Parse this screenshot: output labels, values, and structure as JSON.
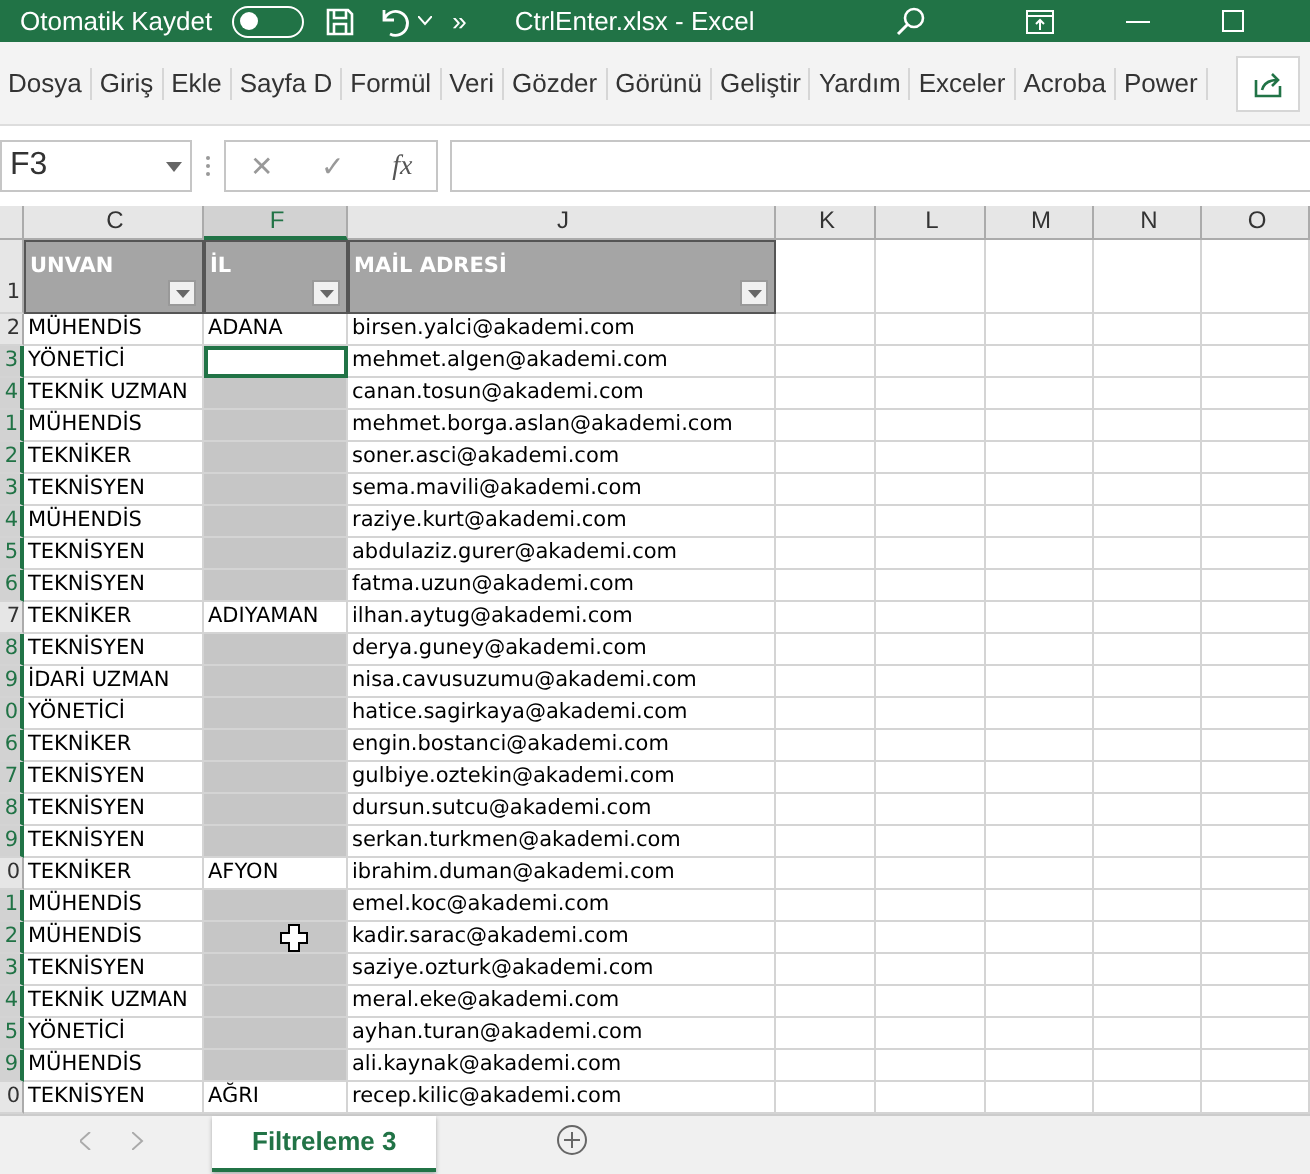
{
  "title_bar": {
    "autosave_label": "Otomatik Kaydet",
    "autosave_on": false,
    "overflow": "»",
    "title": "CtrlEnter.xlsx  -  Excel"
  },
  "ribbon_tabs": [
    "Dosya",
    "Giriş",
    "Ekle",
    "Sayfa D",
    "Formül",
    "Veri",
    "Gözder",
    "Görünü",
    "Geliştir",
    "Yardım",
    "Exceler",
    "Acroba",
    "Power"
  ],
  "formula_bar": {
    "name_box": "F3",
    "cancel": "✕",
    "enter": "✓",
    "fx": "fx"
  },
  "sheet": {
    "column_headers": [
      {
        "label": "C",
        "selected": false
      },
      {
        "label": "F",
        "selected": true
      },
      {
        "label": "J",
        "selected": false
      },
      {
        "label": "K",
        "selected": false
      },
      {
        "label": "L",
        "selected": false
      },
      {
        "label": "M",
        "selected": false
      },
      {
        "label": "N",
        "selected": false
      },
      {
        "label": "O",
        "selected": false
      }
    ],
    "header_row": {
      "row": "1",
      "cells": [
        "UNVAN",
        "İL",
        "MAİL ADRESİ"
      ]
    },
    "rows": [
      {
        "row": "2",
        "unvan": "MÜHENDİS",
        "il": "ADANA",
        "mail": "birsen.yalci@akademi.com",
        "selected": false,
        "active": false
      },
      {
        "row": "3",
        "unvan": "YÖNETİCİ",
        "mail": "mehmet.algen@akademi.com",
        "selected": true,
        "active": true
      },
      {
        "row": "4",
        "unvan": "TEKNİK UZMAN",
        "mail": "canan.tosun@akademi.com",
        "selected": true,
        "active": false
      },
      {
        "row": "1",
        "unvan": "MÜHENDİS",
        "mail": "mehmet.borga.aslan@akademi.com",
        "selected": true,
        "active": false
      },
      {
        "row": "2",
        "unvan": "TEKNİKER",
        "mail": "soner.asci@akademi.com",
        "selected": true,
        "active": false
      },
      {
        "row": "3",
        "unvan": "TEKNİSYEN",
        "mail": "sema.mavili@akademi.com",
        "selected": true,
        "active": false
      },
      {
        "row": "4",
        "unvan": "MÜHENDİS",
        "mail": "raziye.kurt@akademi.com",
        "selected": true,
        "active": false
      },
      {
        "row": "5",
        "unvan": "TEKNİSYEN",
        "mail": "abdulaziz.gurer@akademi.com",
        "selected": true,
        "active": false
      },
      {
        "row": "6",
        "unvan": "TEKNİSYEN",
        "mail": "fatma.uzun@akademi.com",
        "selected": true,
        "active": false
      },
      {
        "row": "7",
        "unvan": "TEKNİKER",
        "il": "ADIYAMAN",
        "mail": "ilhan.aytug@akademi.com",
        "selected": false,
        "active": false
      },
      {
        "row": "8",
        "unvan": "TEKNİSYEN",
        "mail": "derya.guney@akademi.com",
        "selected": true,
        "active": false
      },
      {
        "row": "9",
        "unvan": "İDARİ UZMAN",
        "mail": "nisa.cavusuzumu@akademi.com",
        "selected": true,
        "active": false
      },
      {
        "row": "0",
        "unvan": "YÖNETİCİ",
        "mail": "hatice.sagirkaya@akademi.com",
        "selected": true,
        "active": false
      },
      {
        "row": "6",
        "unvan": "TEKNİKER",
        "mail": "engin.bostanci@akademi.com",
        "selected": true,
        "active": false
      },
      {
        "row": "7",
        "unvan": "TEKNİSYEN",
        "mail": "gulbiye.oztekin@akademi.com",
        "selected": true,
        "active": false
      },
      {
        "row": "8",
        "unvan": "TEKNİSYEN",
        "mail": "dursun.sutcu@akademi.com",
        "selected": true,
        "active": false
      },
      {
        "row": "9",
        "unvan": "TEKNİSYEN",
        "mail": "serkan.turkmen@akademi.com",
        "selected": true,
        "active": false
      },
      {
        "row": "0",
        "unvan": "TEKNİKER",
        "il": "AFYON",
        "mail": "ibrahim.duman@akademi.com",
        "selected": false,
        "active": false
      },
      {
        "row": "1",
        "unvan": "MÜHENDİS",
        "mail": "emel.koc@akademi.com",
        "selected": true,
        "active": false
      },
      {
        "row": "2",
        "unvan": "MÜHENDİS",
        "mail": "kadir.sarac@akademi.com",
        "selected": true,
        "active": false
      },
      {
        "row": "3",
        "unvan": "TEKNİSYEN",
        "mail": "saziye.ozturk@akademi.com",
        "selected": true,
        "active": false
      },
      {
        "row": "4",
        "unvan": "TEKNİK UZMAN",
        "mail": "meral.eke@akademi.com",
        "selected": true,
        "active": false
      },
      {
        "row": "5",
        "unvan": "YÖNETİCİ",
        "mail": "ayhan.turan@akademi.com",
        "selected": true,
        "active": false
      },
      {
        "row": "9",
        "unvan": "MÜHENDİS",
        "mail": "ali.kaynak@akademi.com",
        "selected": true,
        "active": false
      },
      {
        "row": "0",
        "unvan": "TEKNİSYEN",
        "il": "AĞRI",
        "mail": "recep.kilic@akademi.com",
        "selected": false,
        "active": false
      }
    ]
  },
  "sheet_tabs": [
    {
      "label": "Filtreleme 3",
      "selected": true
    }
  ]
}
